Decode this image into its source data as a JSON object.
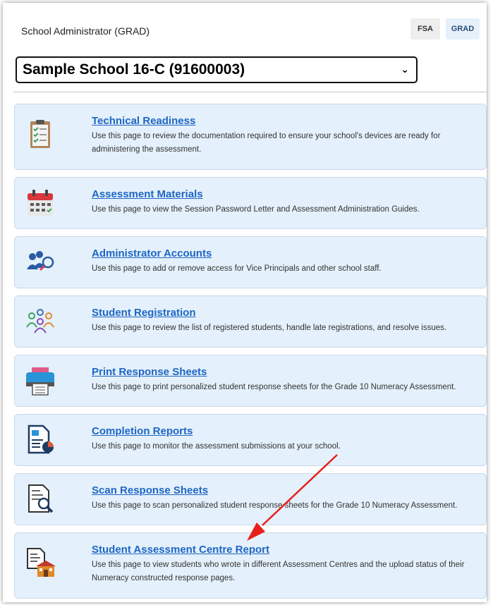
{
  "header": {
    "role": "School Administrator (GRAD)",
    "switch_fsa": "FSA",
    "switch_grad": "GRAD"
  },
  "school_select": {
    "value": "Sample School 16-C (91600003)"
  },
  "cards": [
    {
      "title": "Technical Readiness",
      "desc": "Use this page to review the documentation required to ensure your school's devices are ready for administering the assessment.",
      "icon": "clipboard-checklist-icon"
    },
    {
      "title": "Assessment Materials",
      "desc": "Use this page to view the Session Password Letter and Assessment Administration Guides.",
      "icon": "calendar-icon"
    },
    {
      "title": "Administrator Accounts",
      "desc": "Use this page to add or remove access for Vice Principals and other school staff.",
      "icon": "users-search-icon"
    },
    {
      "title": "Student Registration",
      "desc": "Use this page to review the list of registered students, handle late registrations, and resolve issues.",
      "icon": "students-group-icon"
    },
    {
      "title": "Print Response Sheets",
      "desc": "Use this page to print personalized student response sheets for the Grade 10 Numeracy Assessment.",
      "icon": "printer-icon"
    },
    {
      "title": "Completion Reports",
      "desc": "Use this page to monitor the assessment submissions at your school.",
      "icon": "report-chart-icon"
    },
    {
      "title": "Scan Response Sheets",
      "desc": "Use this page to scan personalized student response sheets for the Grade 10 Numeracy Assessment.",
      "icon": "document-search-icon"
    },
    {
      "title": "Student Assessment Centre Report",
      "desc": "Use this page to view students who wrote in different Assessment Centres and the upload status of their Numeracy constructed response pages.",
      "icon": "document-school-icon"
    }
  ],
  "colors": {
    "link": "#1e66c5",
    "card_bg": "#e4f0fb",
    "arrow": "#e8201a"
  }
}
